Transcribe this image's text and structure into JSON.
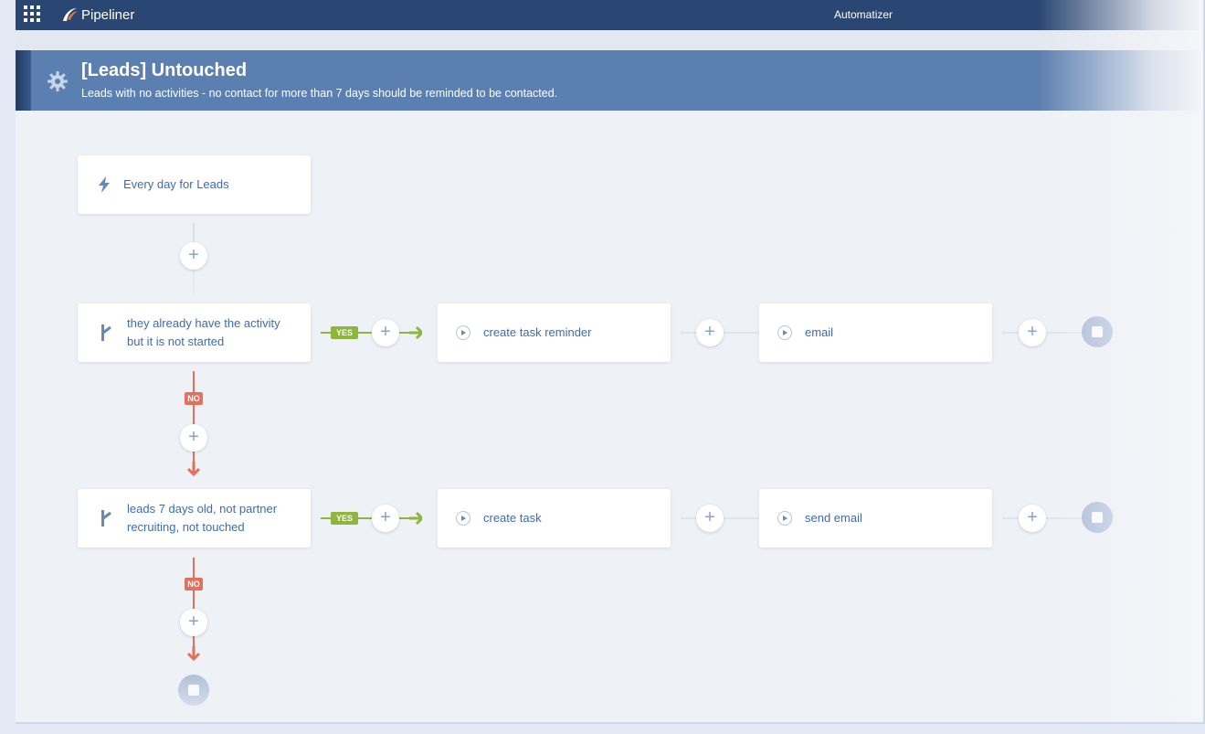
{
  "app": {
    "brand": "Pipeliner",
    "module": "Automatizer"
  },
  "header": {
    "title": "[Leads] Untouched",
    "description": "Leads with no activities - no contact for more than 7 days should be reminded to be contacted."
  },
  "flow": {
    "trigger": {
      "label": "Every day for Leads",
      "icon": "lightning-icon"
    },
    "condition1": {
      "label_line1": "they already have the activity",
      "label_line2": "but it is not started",
      "yes_label": "YES",
      "no_label": "NO",
      "actions": [
        "create task reminder",
        "email"
      ]
    },
    "condition2": {
      "label_line1": "leads 7 days old, not partner",
      "label_line2": "recruiting, not touched",
      "yes_label": "YES",
      "no_label": "NO",
      "actions": [
        "create task",
        "send email"
      ]
    },
    "add_symbol": "+"
  },
  "colors": {
    "topbar": "#2a4773",
    "header": "#5c7fb1",
    "yes": "#8cb63c",
    "no": "#e3705c",
    "label_text": "#3e6bb0"
  }
}
